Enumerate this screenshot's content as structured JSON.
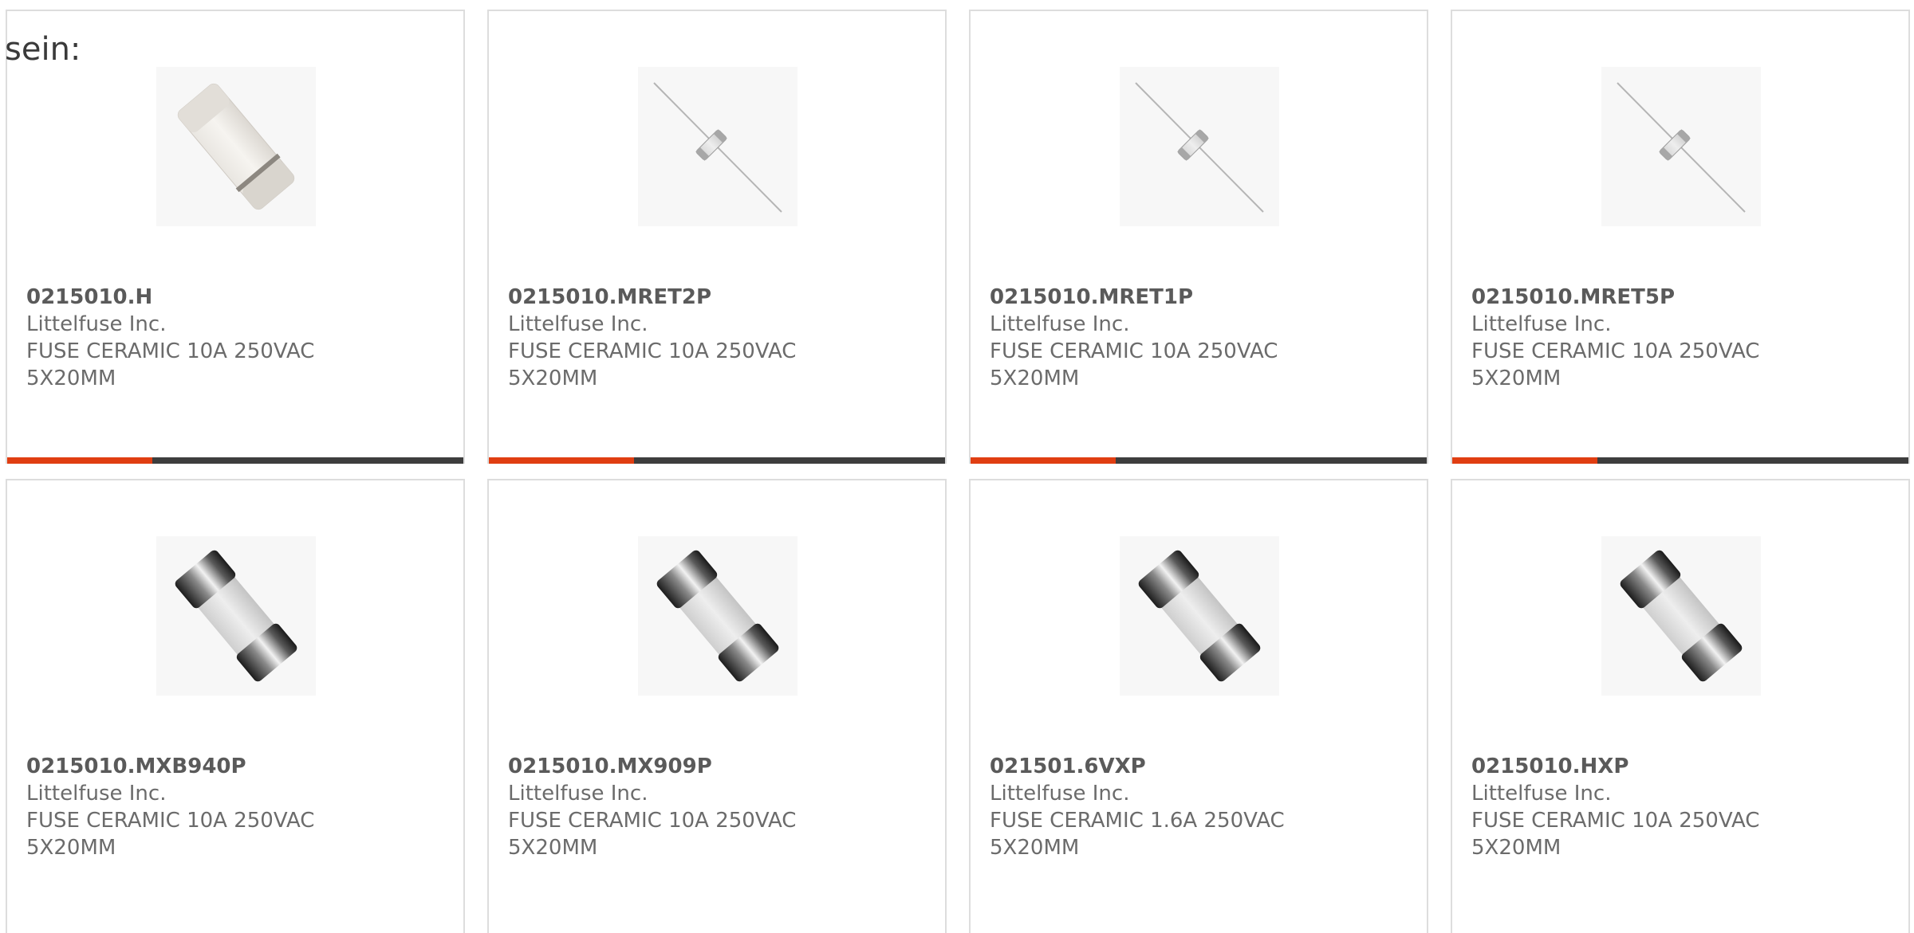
{
  "intro_text": "sein:",
  "colors": {
    "accent": "#e03e12",
    "bar_dark": "#3d3d3d",
    "text": "#6b6b6b"
  },
  "products": [
    {
      "part_number": "0215010.H",
      "manufacturer": "Littelfuse Inc.",
      "description_line1": "FUSE CERAMIC 10A 250VAC",
      "description_line2": "5X20MM",
      "image_icon": "ceramic-fuse-white-icon"
    },
    {
      "part_number": "0215010.MRET2P",
      "manufacturer": "Littelfuse Inc.",
      "description_line1": "FUSE CERAMIC 10A 250VAC",
      "description_line2": "5X20MM",
      "image_icon": "axial-lead-fuse-icon"
    },
    {
      "part_number": "0215010.MRET1P",
      "manufacturer": "Littelfuse Inc.",
      "description_line1": "FUSE CERAMIC 10A 250VAC",
      "description_line2": "5X20MM",
      "image_icon": "axial-lead-fuse-icon"
    },
    {
      "part_number": "0215010.MRET5P",
      "manufacturer": "Littelfuse Inc.",
      "description_line1": "FUSE CERAMIC 10A 250VAC",
      "description_line2": "5X20MM",
      "image_icon": "axial-lead-fuse-icon"
    },
    {
      "part_number": "0215010.MXB940P",
      "manufacturer": "Littelfuse Inc.",
      "description_line1": "FUSE CERAMIC 10A 250VAC",
      "description_line2": "5X20MM",
      "image_icon": "cartridge-fuse-metal-caps-icon"
    },
    {
      "part_number": "0215010.MX909P",
      "manufacturer": "Littelfuse Inc.",
      "description_line1": "FUSE CERAMIC 10A 250VAC",
      "description_line2": "5X20MM",
      "image_icon": "cartridge-fuse-metal-caps-icon"
    },
    {
      "part_number": "021501.6VXP",
      "manufacturer": "Littelfuse Inc.",
      "description_line1": "FUSE CERAMIC 1.6A 250VAC",
      "description_line2": "5X20MM",
      "image_icon": "cartridge-fuse-metal-caps-icon"
    },
    {
      "part_number": "0215010.HXP",
      "manufacturer": "Littelfuse Inc.",
      "description_line1": "FUSE CERAMIC 10A 250VAC",
      "description_line2": "5X20MM",
      "image_icon": "cartridge-fuse-metal-caps-icon"
    }
  ]
}
